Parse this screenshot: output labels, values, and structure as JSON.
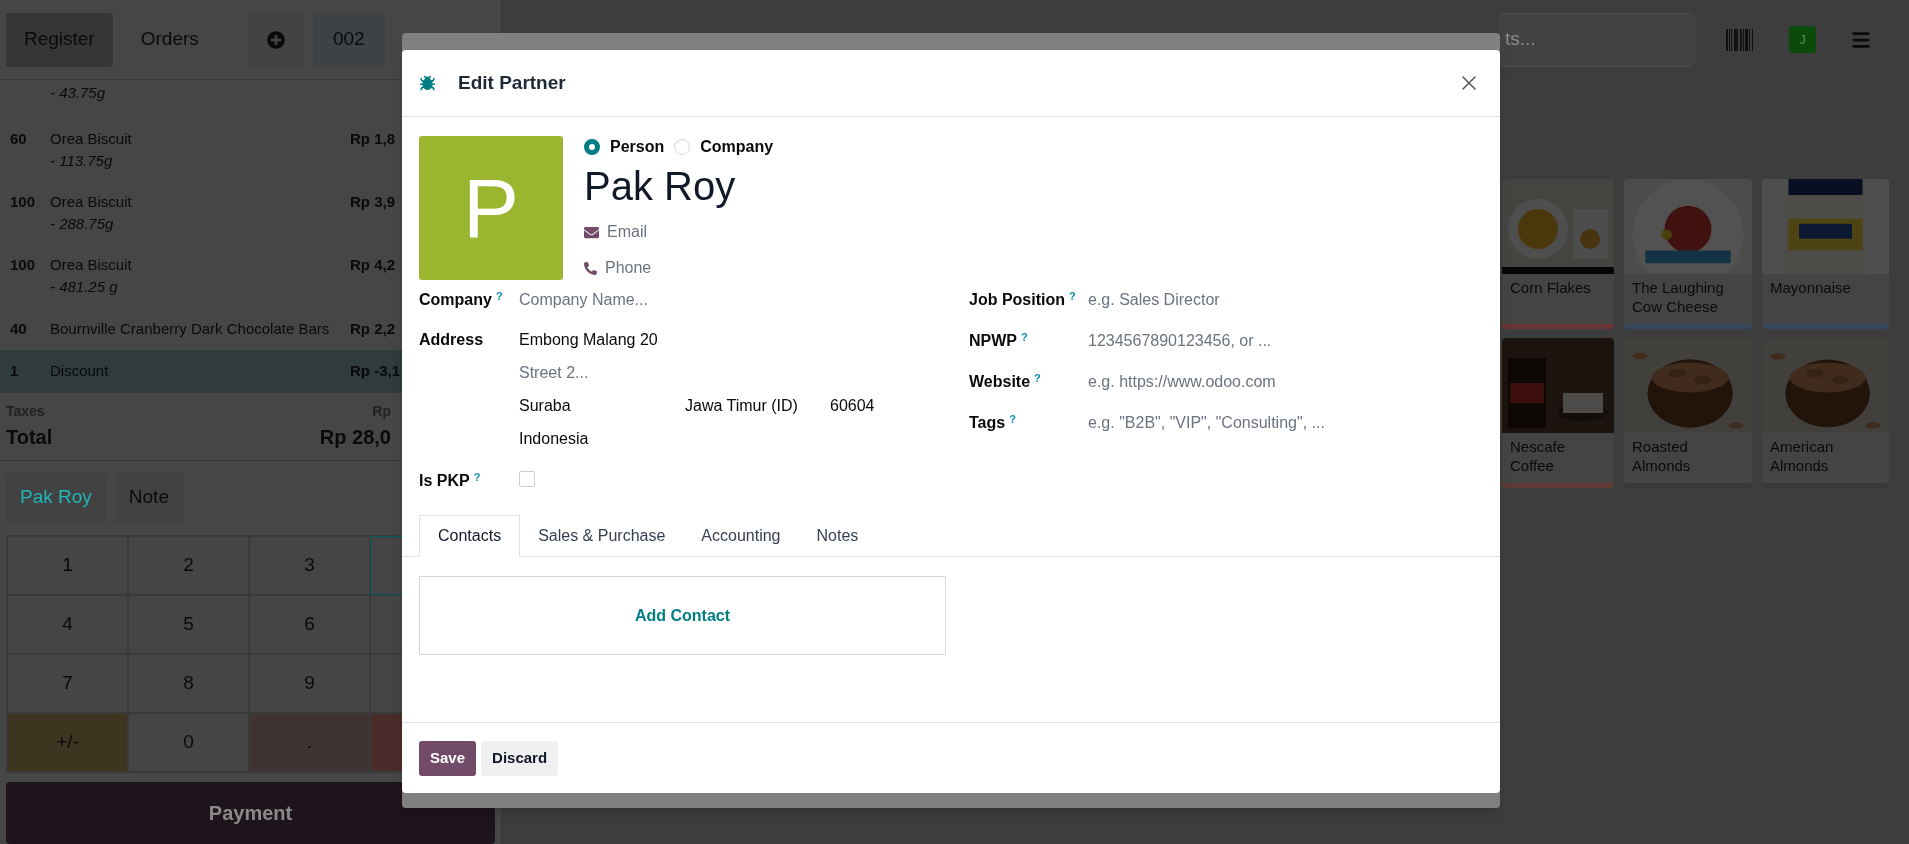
{
  "pos_header": {
    "tabs": [
      {
        "label": "Register",
        "selected": true
      },
      {
        "label": "Orders",
        "selected": false
      }
    ],
    "order_number": "002"
  },
  "order_lines": [
    {
      "note": "- 43.75g",
      "selected": false
    },
    {
      "qty": "60",
      "name": "Orea Biscuit",
      "note": "- 113.75g",
      "price": "Rp 1,8",
      "selected": false
    },
    {
      "qty": "100",
      "name": "Orea Biscuit",
      "note": "- 288.75g",
      "price": "Rp 3,9",
      "selected": false
    },
    {
      "qty": "100",
      "name": "Orea Biscuit",
      "note": "- 481.25 g",
      "price": "Rp 4,2",
      "selected": false
    },
    {
      "qty": "40",
      "name": "Bournville Cranberry Dark Chocolate Bars",
      "price": "Rp 2,2",
      "selected": false
    },
    {
      "qty": "1",
      "name": "Discount",
      "price": "Rp -3,1",
      "selected": true
    }
  ],
  "totals": {
    "taxes_label": "Taxes",
    "taxes_value": "Rp",
    "total_label": "Total",
    "total_value": "Rp 28,0"
  },
  "customer_buttons": [
    {
      "label": "Pak Roy",
      "kind": "customer"
    },
    {
      "label": "Note",
      "kind": "plain"
    }
  ],
  "numpad": [
    {
      "label": "1",
      "kind": "digit"
    },
    {
      "label": "2",
      "kind": "digit"
    },
    {
      "label": "3",
      "kind": "digit"
    },
    {
      "kind": "mode",
      "selected": true
    },
    {
      "label": "4",
      "kind": "digit"
    },
    {
      "label": "5",
      "kind": "digit"
    },
    {
      "label": "6",
      "kind": "digit"
    },
    {
      "kind": "mode",
      "selected": false
    },
    {
      "label": "7",
      "kind": "digit"
    },
    {
      "label": "8",
      "kind": "digit"
    },
    {
      "label": "9",
      "kind": "digit"
    },
    {
      "kind": "mode",
      "selected": false
    },
    {
      "label": "+/-",
      "kind": "sign"
    },
    {
      "label": "0",
      "kind": "digit"
    },
    {
      "label": ".",
      "kind": "decimal"
    },
    {
      "kind": "delete"
    }
  ],
  "payment_button": "Payment",
  "search": {
    "placeholder": "ts..."
  },
  "user_avatar": "J",
  "products": [
    {
      "name": "Corn Flakes",
      "color": "#6b3434",
      "kind": "picture"
    },
    {
      "name": "The Laughing Cow Cheese",
      "color": "#36465c",
      "kind": "picture"
    },
    {
      "name": "Mayonnaise",
      "color": "#36465c",
      "kind": "picture"
    },
    {
      "name": "Nescafe Coffee",
      "color": "#5e3a33",
      "kind": "picture"
    },
    {
      "name": "Roasted Almonds",
      "color": "#383838",
      "kind": "picture"
    },
    {
      "name": "American Almonds",
      "color": "#383838",
      "kind": "picture"
    }
  ],
  "dialog": {
    "title": "Edit Partner",
    "partner_type": [
      {
        "label": "Person",
        "selected": true
      },
      {
        "label": "Company",
        "selected": false
      }
    ],
    "avatar_letter": "P",
    "name": "Pak Roy",
    "email_placeholder": "Email",
    "phone_placeholder": "Phone",
    "left_fields": [
      {
        "label": "Company",
        "help": "?",
        "kind": "text",
        "placeholder": "Company Name..."
      },
      {
        "label": "Address",
        "kind": "address",
        "street": "Embong Malang 20",
        "street2_placeholder": "Street 2...",
        "city": "Suraba",
        "state": "Jawa Timur (ID)",
        "zip": "60604",
        "country": "Indonesia"
      },
      {
        "label": "Is PKP",
        "help": "?",
        "kind": "checkbox",
        "checked": false
      }
    ],
    "right_fields": [
      {
        "label": "Job Position",
        "help": "?",
        "placeholder": "e.g. Sales Director"
      },
      {
        "label": "NPWP",
        "help": "?",
        "placeholder": "1234567890123456, or ..."
      },
      {
        "label": "Website",
        "help": "?",
        "placeholder": "e.g. https://www.odoo.com"
      },
      {
        "label": "Tags",
        "help": "?",
        "placeholder": "e.g. \"B2B\", \"VIP\", \"Consulting\", ..."
      }
    ],
    "tabs": [
      {
        "label": "Contacts",
        "selected": true
      },
      {
        "label": "Sales & Purchase",
        "selected": false
      },
      {
        "label": "Accounting",
        "selected": false
      },
      {
        "label": "Notes",
        "selected": false
      }
    ],
    "add_contact": "Add Contact",
    "buttons": [
      {
        "label": "Save",
        "kind": "primary"
      },
      {
        "label": "Discard",
        "kind": "secondary"
      }
    ]
  }
}
